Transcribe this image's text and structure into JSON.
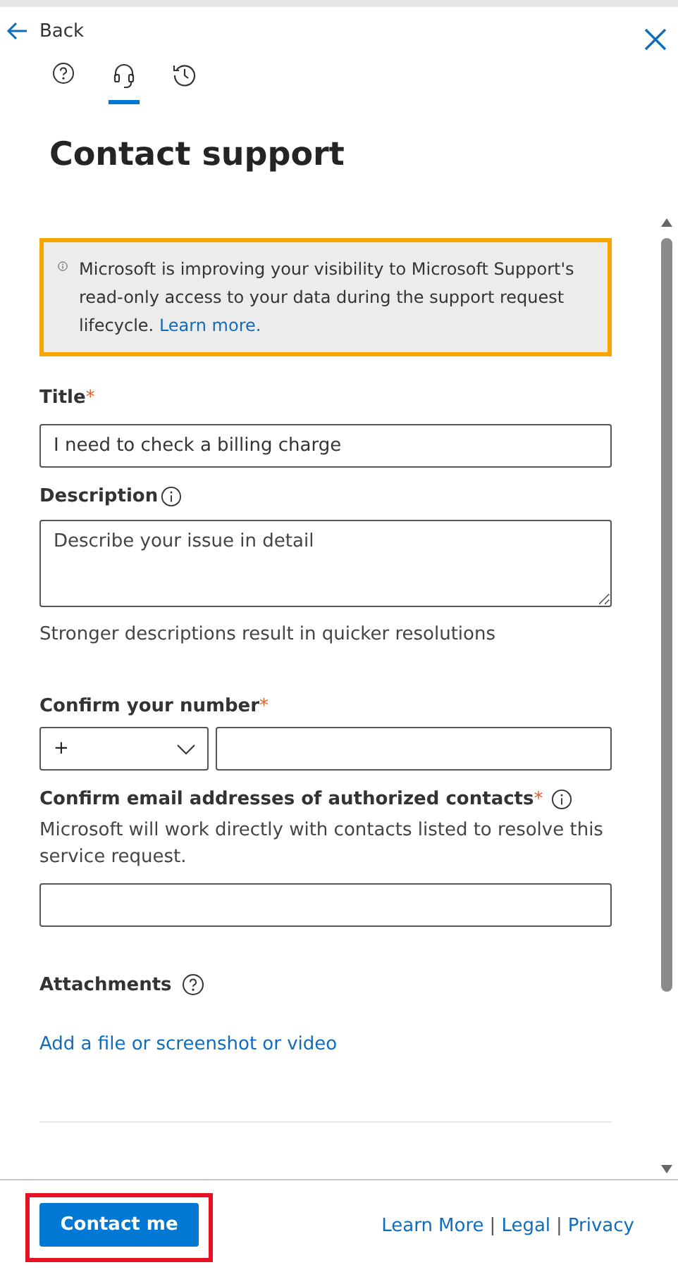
{
  "header": {
    "back": "Back"
  },
  "tabs": [
    {
      "kind": "help",
      "selected": false
    },
    {
      "kind": "headset",
      "selected": true
    },
    {
      "kind": "history",
      "selected": false
    }
  ],
  "title": "Contact support",
  "notice": {
    "text": "Microsoft is improving your visibility to Microsoft Support's read-only access to your data during the support request lifecycle.",
    "link": "Learn more."
  },
  "form": {
    "title": {
      "label": "Title",
      "required": "*",
      "value": "I need to check a billing charge"
    },
    "description": {
      "label": "Description",
      "placeholder": "Describe your issue in detail",
      "hint": "Stronger descriptions result in quicker resolutions"
    },
    "phone": {
      "label": "Confirm your number",
      "required": "*",
      "code": "+"
    },
    "email": {
      "label": "Confirm email addresses of authorized contacts",
      "required": "*",
      "help": "Microsoft will work directly with contacts listed to resolve this service request."
    },
    "attachments": {
      "label": "Attachments",
      "link": "Add a file or screenshot or video"
    }
  },
  "footer": {
    "button": {
      "label": "Contact me",
      "highlighted": true
    },
    "links": [
      "Learn More",
      "Legal",
      "Privacy"
    ],
    "separator": "|"
  }
}
